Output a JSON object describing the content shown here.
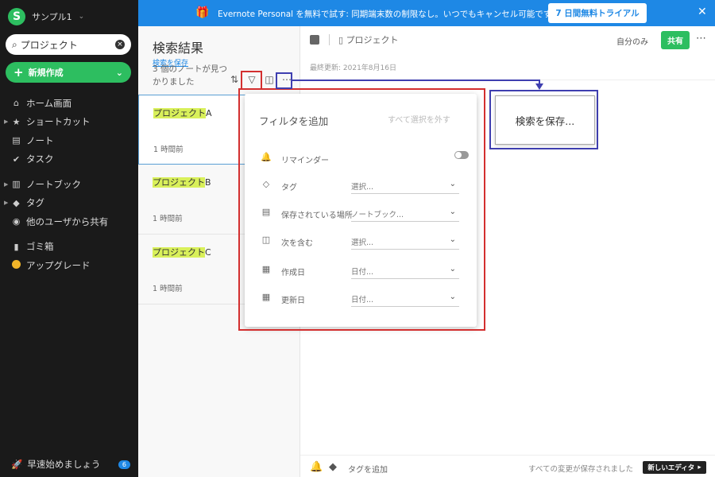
{
  "sidebar": {
    "avatar_letter": "S",
    "username": "サンプル1",
    "search_value": "プロジェクト",
    "new_label": "新規作成",
    "items": [
      {
        "label": "ホーム画面",
        "icon": "⌂"
      },
      {
        "label": "ショートカット",
        "icon": "★"
      },
      {
        "label": "ノート",
        "icon": "▤"
      },
      {
        "label": "タスク",
        "icon": "✔"
      },
      {
        "label": "ノートブック",
        "icon": "▥"
      },
      {
        "label": "タグ",
        "icon": "◆"
      },
      {
        "label": "他のユーザから共有",
        "icon": "◉"
      },
      {
        "label": "ゴミ箱",
        "icon": "▮"
      },
      {
        "label": "アップグレード",
        "icon": ""
      }
    ],
    "footer_label": "早速始めましょう",
    "footer_badge": "6"
  },
  "banner": {
    "text": "Evernote Personal を無料で試す: 同期端末数の制限なし。いつでもキャンセル可能です。",
    "button_label": "7 日間無料トライアル",
    "color": "#1e88e5"
  },
  "note_list": {
    "title": "検索結果",
    "save_search_link": "検索を保存",
    "count_text": "3 個のノートが見つかりました",
    "notes": [
      {
        "highlight": "プロジェクト",
        "suffix": "A",
        "time": "1 時間前"
      },
      {
        "highlight": "プロジェクト",
        "suffix": "B",
        "time": "1 時間前"
      },
      {
        "highlight": "プロジェクト",
        "suffix": "C",
        "time": "1 時間前"
      }
    ]
  },
  "editor": {
    "notebook": "プロジェクト",
    "share_scope": "自分のみ",
    "share_button": "共有",
    "last_updated": "最終更新: 2021年8月16日",
    "add_tag": "タグを追加",
    "saved_status": "すべての変更が保存されました",
    "new_editor": "新しいエディタ"
  },
  "filter": {
    "heading": "フィルタを追加",
    "clear_all": "すべて選択を外す",
    "rows": [
      {
        "label": "リマインダー",
        "value": "",
        "icon": "🔔"
      },
      {
        "label": "タグ",
        "value": "選択...",
        "icon": "◇"
      },
      {
        "label": "保存されている場所",
        "value": "ノートブック...",
        "icon": "▤"
      },
      {
        "label": "次を含む",
        "value": "選択...",
        "icon": "◫"
      },
      {
        "label": "作成日",
        "value": "日付...",
        "icon": "▦"
      },
      {
        "label": "更新日",
        "value": "日付...",
        "icon": "▦"
      }
    ]
  },
  "callout": {
    "label": "検索を保存..."
  },
  "colors": {
    "green": "#2dbe60",
    "blue": "#1e88e5",
    "annotation_red": "#d32f2f",
    "annotation_blue": "#3f3fb0",
    "highlight": "#d9f05a"
  }
}
